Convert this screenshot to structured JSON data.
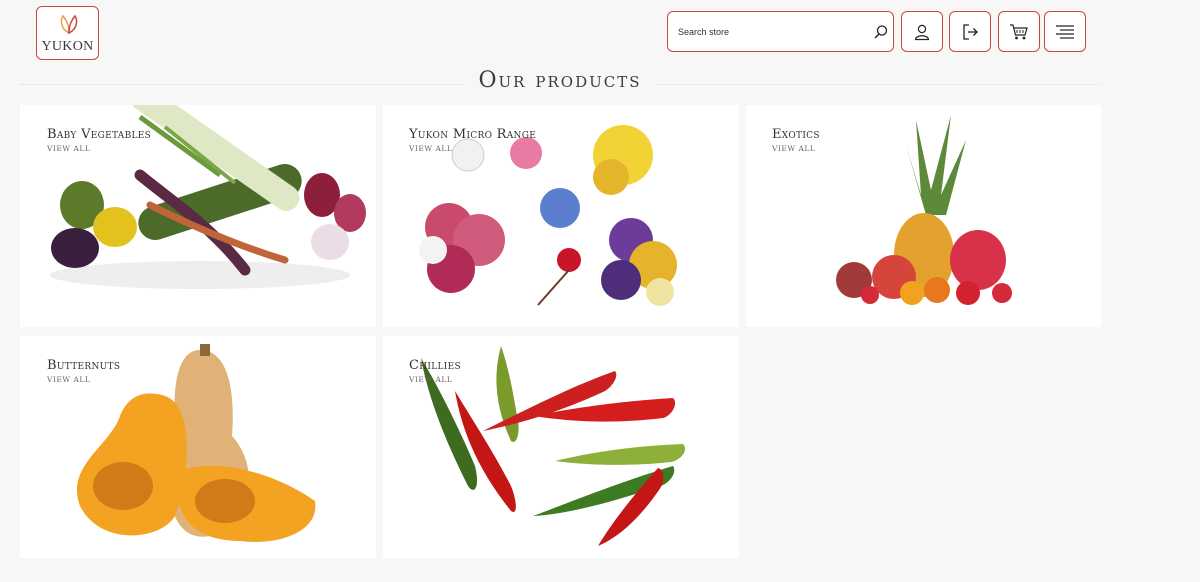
{
  "header": {
    "logo_text": "YUKON",
    "search": {
      "placeholder": "Search store"
    },
    "icons": [
      "user-icon",
      "logout-icon",
      "cart-icon",
      "menu-icon"
    ]
  },
  "main": {
    "heading": "Our products",
    "categories": [
      {
        "name": "Baby Vegetables",
        "link": "VIEW ALL"
      },
      {
        "name": "Yukon Micro Range",
        "link": "VIEW ALL"
      },
      {
        "name": "Exotics",
        "link": "VIEW ALL"
      },
      {
        "name": "Butternuts",
        "link": "VIEW ALL"
      },
      {
        "name": "Chillies",
        "link": "VIEW ALL"
      }
    ]
  },
  "colors": {
    "accent": "#c9473f",
    "background": "#f7f7f7",
    "card": "#ffffff"
  }
}
